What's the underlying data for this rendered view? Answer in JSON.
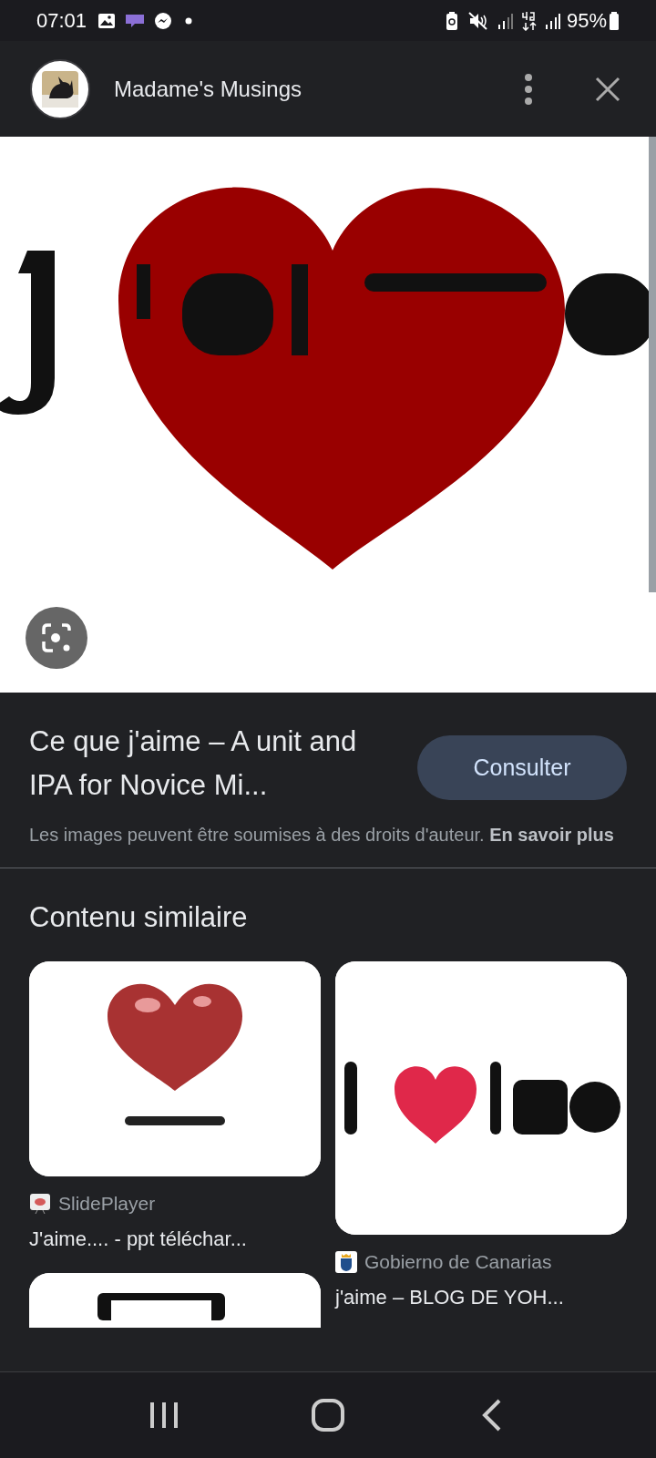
{
  "status_bar": {
    "time": "07:01",
    "battery": "95%"
  },
  "header": {
    "title": "Madame's Musings"
  },
  "image": {
    "kind": "picture"
  },
  "result": {
    "title": "Ce que j'aime – A unit and IPA for Novice Mi...",
    "button": "Consulter",
    "notice": "Les images peuvent être soumises à des droits d'auteur. **En savoir plus**"
  },
  "similar": {
    "heading": "Contenu similaire",
    "items": [
      {
        "image": {
          "kind": "picture"
        },
        "source": "SlidePlayer",
        "title": "J'aime.... - ppt téléchar..."
      },
      {
        "image": {
          "kind": "picture"
        },
        "source": "Gobierno de Canarias",
        "title": "j'aime – BLOG DE YOH..."
      },
      {
        "image": {
          "kind": "picture"
        }
      }
    ]
  }
}
